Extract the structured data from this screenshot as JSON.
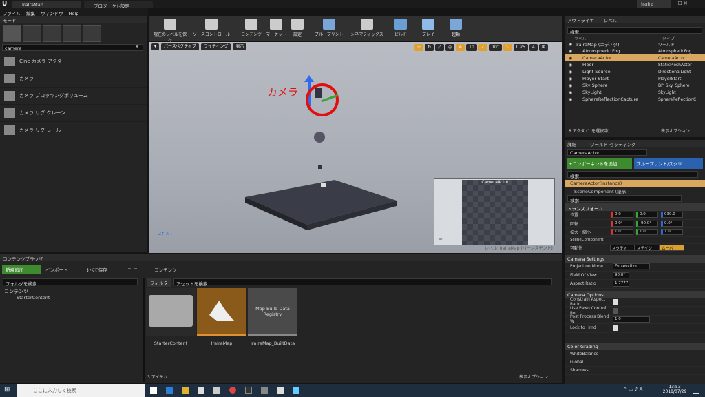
{
  "window": {
    "tab1": "IraIraMap",
    "tab2": "プロジェクト設定",
    "user": "IraIra"
  },
  "menu": [
    "ファイル",
    "編集",
    "ウィンドウ",
    "Help"
  ],
  "modes": {
    "header": "モード",
    "search_value": "camera",
    "items": [
      "Cine カメラ アクタ",
      "カメラ",
      "カメラ ブロッキングボリューム",
      "カメラ リグ クレーン",
      "カメラ リグ レール"
    ]
  },
  "toolbar": [
    "現在のレベルを保存",
    "ソースコントロール",
    "コンテンツ",
    "マーケット",
    "設定",
    "ブループリント",
    "シネマティックス",
    "ビルド",
    "プレイ",
    "起動"
  ],
  "viewport": {
    "perspective": "パースペクティブ",
    "lighting": "ライティング",
    "show": "表示",
    "grid": "10",
    "angle": "10°",
    "scale": "0.25",
    "speed": "4",
    "annotation": "カメラ",
    "preview_title": "CameraActor",
    "level_label": "レベル: IraIraMap (パーシステント)"
  },
  "outliner": {
    "tab1": "アウトライナ",
    "tab2": "レベル",
    "col_label": "ラベル",
    "col_type": "タイプ",
    "rows": [
      {
        "label": "IraIraMap (エディタ)",
        "type": "ワールド"
      },
      {
        "label": "Atmospheric Fog",
        "type": "AtmosphericFog"
      },
      {
        "label": "CameraActor",
        "type": "CameraActor"
      },
      {
        "label": "Floor",
        "type": "StaticMeshActor"
      },
      {
        "label": "Light Source",
        "type": "DirectionalLight"
      },
      {
        "label": "Player Start",
        "type": "PlayerStart"
      },
      {
        "label": "Sky Sphere",
        "type": "BP_Sky_Sphere"
      },
      {
        "label": "SkyLight",
        "type": "SkyLight"
      },
      {
        "label": "SphereReflectionCapture",
        "type": "SphereReflectionC"
      }
    ],
    "count": "8 アクタ (1 を選択中)",
    "view_options": "表示オプション"
  },
  "details": {
    "tab1": "詳細",
    "tab2": "ワールド セッティング",
    "name": "CameraActor",
    "add_component": "+コンポーネントを追加",
    "blueprint": "ブループリント/スクリ",
    "search": "検索",
    "instance": "CameraActor(Instance)",
    "scene_comp": "SceneComponent (継承)",
    "transform_header": "トランスフォーム",
    "loc_label": "位置",
    "rot_label": "回転",
    "scale_label": "拡大・縮小",
    "loc": [
      "0.0",
      "0.0",
      "930.0"
    ],
    "rot": [
      "0.0°",
      "-90.0°",
      "0.0°"
    ],
    "scale": [
      "1.0",
      "1.0",
      "1.0"
    ],
    "scene_component": "SceneComponent",
    "mobility": "可動性",
    "mob_opts": [
      "スタティ",
      "ステイシ",
      "ムーバ"
    ],
    "camera_settings": "Camera Settings",
    "projection_mode": "Projection Mode",
    "projection_value": "Perspective",
    "fov": "Field Of View",
    "fov_value": "90.0°",
    "aspect": "Aspect Ratio",
    "aspect_value": "1.7777",
    "camera_options": "Camera Options",
    "constrain": "Constrain Aspect Ratio",
    "pawn": "Use Pawn Control Rot",
    "blend": "Post Process Blend W",
    "blend_value": "1.0",
    "lock": "Lock to Hmd",
    "color_grading": "Color Grading",
    "white_balance": "WhiteBalance",
    "global": "Global",
    "shadows": "Shadows"
  },
  "content_browser": {
    "tab": "コンテンツブラウザ",
    "add_new": "新規追加",
    "import": "インポート",
    "save_all": "すべて保存",
    "path": "コンテンツ",
    "filter": "フィルタ",
    "search_folders": "フォルダを検索",
    "search_assets": "アセットを検索",
    "tree_root": "コンテンツ",
    "tree_child": "StarterContent",
    "assets": [
      "StarterContent",
      "IraIraMap",
      "IraIraMap_BuiltData"
    ],
    "registry_text": "Map Build Data Registry",
    "count": "3 アイテム",
    "view_options": "表示オプション"
  },
  "taskbar": {
    "search_placeholder": "ここに入力して検索",
    "time": "13:53",
    "date": "2018/07/29"
  }
}
